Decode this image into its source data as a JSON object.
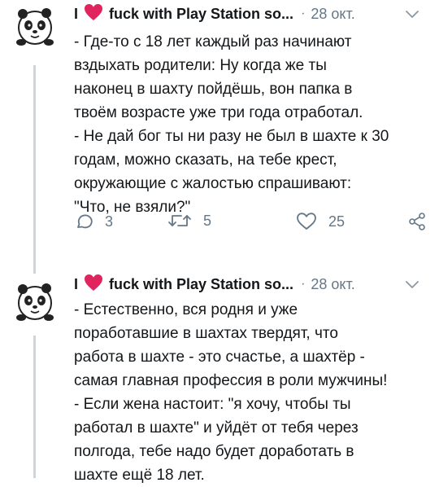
{
  "tweets": [
    {
      "name_prefix": "I",
      "name_suffix": "fuck with Play Station so...",
      "separator": "·",
      "date": "28 окт.",
      "lines": [
        "- Где-то с 18 лет каждый раз начинают",
        "вздыхать родители: Ну когда же ты",
        "наконец в шахту пойдёшь, вон папка в",
        "твоём возрасте уже три года отработал.",
        "- Не дай бог ты ни разу не был в шахте к 30",
        "годам, можно сказать, на тебе крест,",
        "окружающие с жалостью спрашивают:",
        "\"Что, не взяли?\""
      ],
      "replies": "3",
      "retweets": "5",
      "likes": "25"
    },
    {
      "name_prefix": "I",
      "name_suffix": "fuck with Play Station so...",
      "separator": "·",
      "date": "28 окт.",
      "lines": [
        "- Естественно, вся родня и уже",
        "поработавшие в шахтах твердят, что",
        "работа в шахте - это счастье, а шахтёр -",
        "самая главная профессия в роли мужчины!",
        "- Если жена настоит: \"я хочу, чтобы ты",
        "работал в шахте\" и уйдёт от тебя через",
        "полгода, тебе надо будет доработать в",
        "шахте ещё 18 лет."
      ]
    }
  ],
  "icons": {
    "avatar": "panda-avatar-icon",
    "heart": "red-heart-emoji-icon",
    "chevron": "chevron-down-icon",
    "reply": "reply-icon",
    "retweet": "retweet-icon",
    "like": "like-icon",
    "share": "share-icon"
  },
  "colors": {
    "heart": "#e0245e",
    "meta": "#657786",
    "text": "#14171a",
    "thread": "#ccd6dd"
  }
}
